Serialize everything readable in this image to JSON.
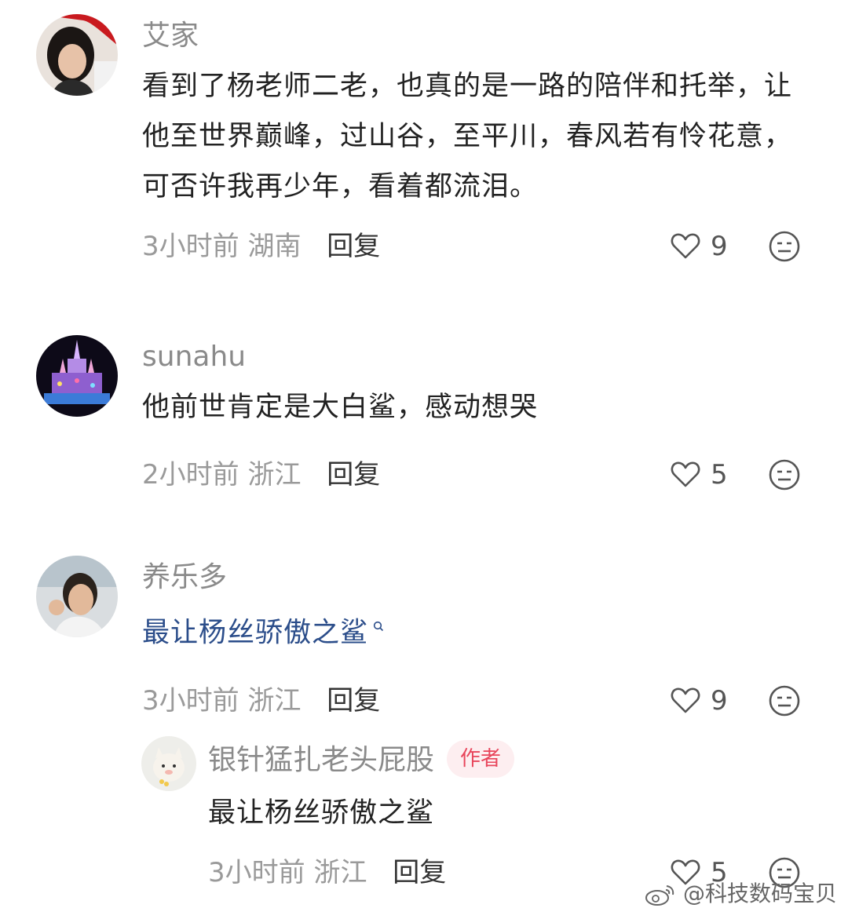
{
  "comments": [
    {
      "username": "艾家",
      "text": "看到了杨老师二老，也真的是一路的陪伴和托举，让他至世界巅峰，过山谷，至平川，春风若有怜花意，可否许我再少年，看着都流泪。",
      "time": "3小时前",
      "location": "湖南",
      "reply_label": "回复",
      "likes": "9"
    },
    {
      "username": "sunahu",
      "text": "他前世肯定是大白鲨，感动想哭",
      "time": "2小时前",
      "location": "浙江",
      "reply_label": "回复",
      "likes": "5"
    },
    {
      "username": "养乐多",
      "text": "最让杨丝骄傲之鲨",
      "time": "3小时前",
      "location": "浙江",
      "reply_label": "回复",
      "likes": "9",
      "reply": {
        "username": "银针猛扎老头屁股",
        "badge": "作者",
        "text": "最让杨丝骄傲之鲨",
        "time": "3小时前",
        "location": "浙江",
        "reply_label": "回复",
        "likes": "5"
      }
    }
  ],
  "watermark": "@科技数码宝贝",
  "colors": {
    "link_text": "#2b4d8a",
    "badge_text": "#e8455b",
    "badge_bg": "#fdeef0",
    "meta_text": "#9a9a9a"
  },
  "icons": [
    "heart-icon",
    "emoji-meh-icon",
    "search-icon",
    "weibo-logo-icon"
  ]
}
